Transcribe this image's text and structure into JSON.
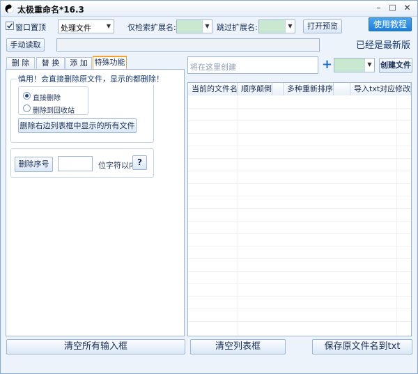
{
  "window": {
    "title": "太极重命名*16.3",
    "minimize": "–",
    "maximize": "□",
    "close": "✕"
  },
  "toolbar": {
    "topmost_label": "窗口置顶",
    "topmost_checked": true,
    "process_select_value": "处理文件",
    "only_ext_label": "仅检索扩展名:",
    "only_ext_value": "",
    "skip_ext_label": "跳过扩展名:",
    "skip_ext_value": "",
    "open_preview_label": "打开预览",
    "tutorial_label": "使用教程",
    "manual_read_label": "手动读取",
    "path_value": "",
    "version_status": "已经是最新版"
  },
  "tabs": [
    {
      "label": "删 除",
      "active": false
    },
    {
      "label": "替 换",
      "active": false
    },
    {
      "label": "添 加",
      "active": false
    },
    {
      "label": "特殊功能",
      "active": true
    }
  ],
  "special": {
    "warning_text": "慎用！会直接删除原文件，显示的都删除！",
    "radio_direct_label": "直接删除",
    "radio_recycle_label": "删除到回收站",
    "radio_selected": "direct",
    "delete_all_label": "删除右边列表框中显示的所有文件",
    "delete_seq_label": "删除序号",
    "seq_value": "",
    "within_label": "位字符以内",
    "help_label": "?"
  },
  "right": {
    "create_placeholder": "将在这里创建",
    "plus": "+",
    "type_select_value": "",
    "create_file_label": "创建文件",
    "columns": [
      {
        "label": "当前的文件名"
      },
      {
        "label": "顺序颠倒"
      },
      {
        "label": ""
      },
      {
        "label": "多种重新排序"
      },
      {
        "label": ""
      },
      {
        "label": "导入txt对应修改"
      }
    ]
  },
  "bottom": {
    "clear_inputs_label": "清空所有输入框",
    "clear_list_label": "清空列表框",
    "save_names_label": "保存原文件名到txt"
  },
  "colors": {
    "accent": "#1f7fd8",
    "window_bg": "#ecf3fb",
    "tab_active_border": "#f0a22e",
    "ext_field_bg": "#c8e8cf"
  }
}
